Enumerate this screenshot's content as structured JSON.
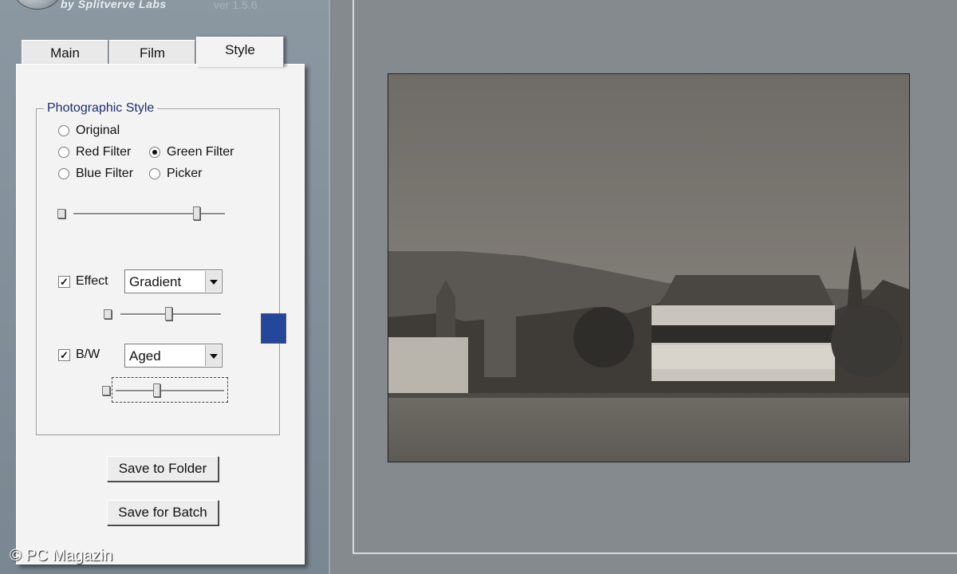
{
  "header": {
    "tagline": "by Splitverve Labs",
    "version": "ver 1.5.6"
  },
  "tabs": [
    {
      "label": "Main",
      "active": false
    },
    {
      "label": "Film",
      "active": false
    },
    {
      "label": "Style",
      "active": true
    }
  ],
  "style_tab": {
    "group_title": "Photographic Style",
    "radios": [
      {
        "label": "Original",
        "checked": false
      },
      {
        "label": "Red Filter",
        "checked": false
      },
      {
        "label": "Green Filter",
        "checked": true
      },
      {
        "label": "Blue Filter",
        "checked": false
      },
      {
        "label": "Picker",
        "checked": false
      }
    ],
    "filter_slider": {
      "value": 0.83
    },
    "effect": {
      "label": "Effect",
      "checked": true,
      "check_mark": "✓",
      "selected": "Gradient",
      "color": "#24479b",
      "slider_value": 0.48
    },
    "bw": {
      "label": "B/W",
      "checked": true,
      "check_mark": "✓",
      "selected": "Aged",
      "slider_value": 0.37
    },
    "buttons": {
      "save_to_folder": "Save to Folder",
      "save_for_batch": "Save for Batch"
    }
  },
  "preview": {
    "tone": "sepia-grayscale"
  },
  "watermark": "© PC Magazin"
}
